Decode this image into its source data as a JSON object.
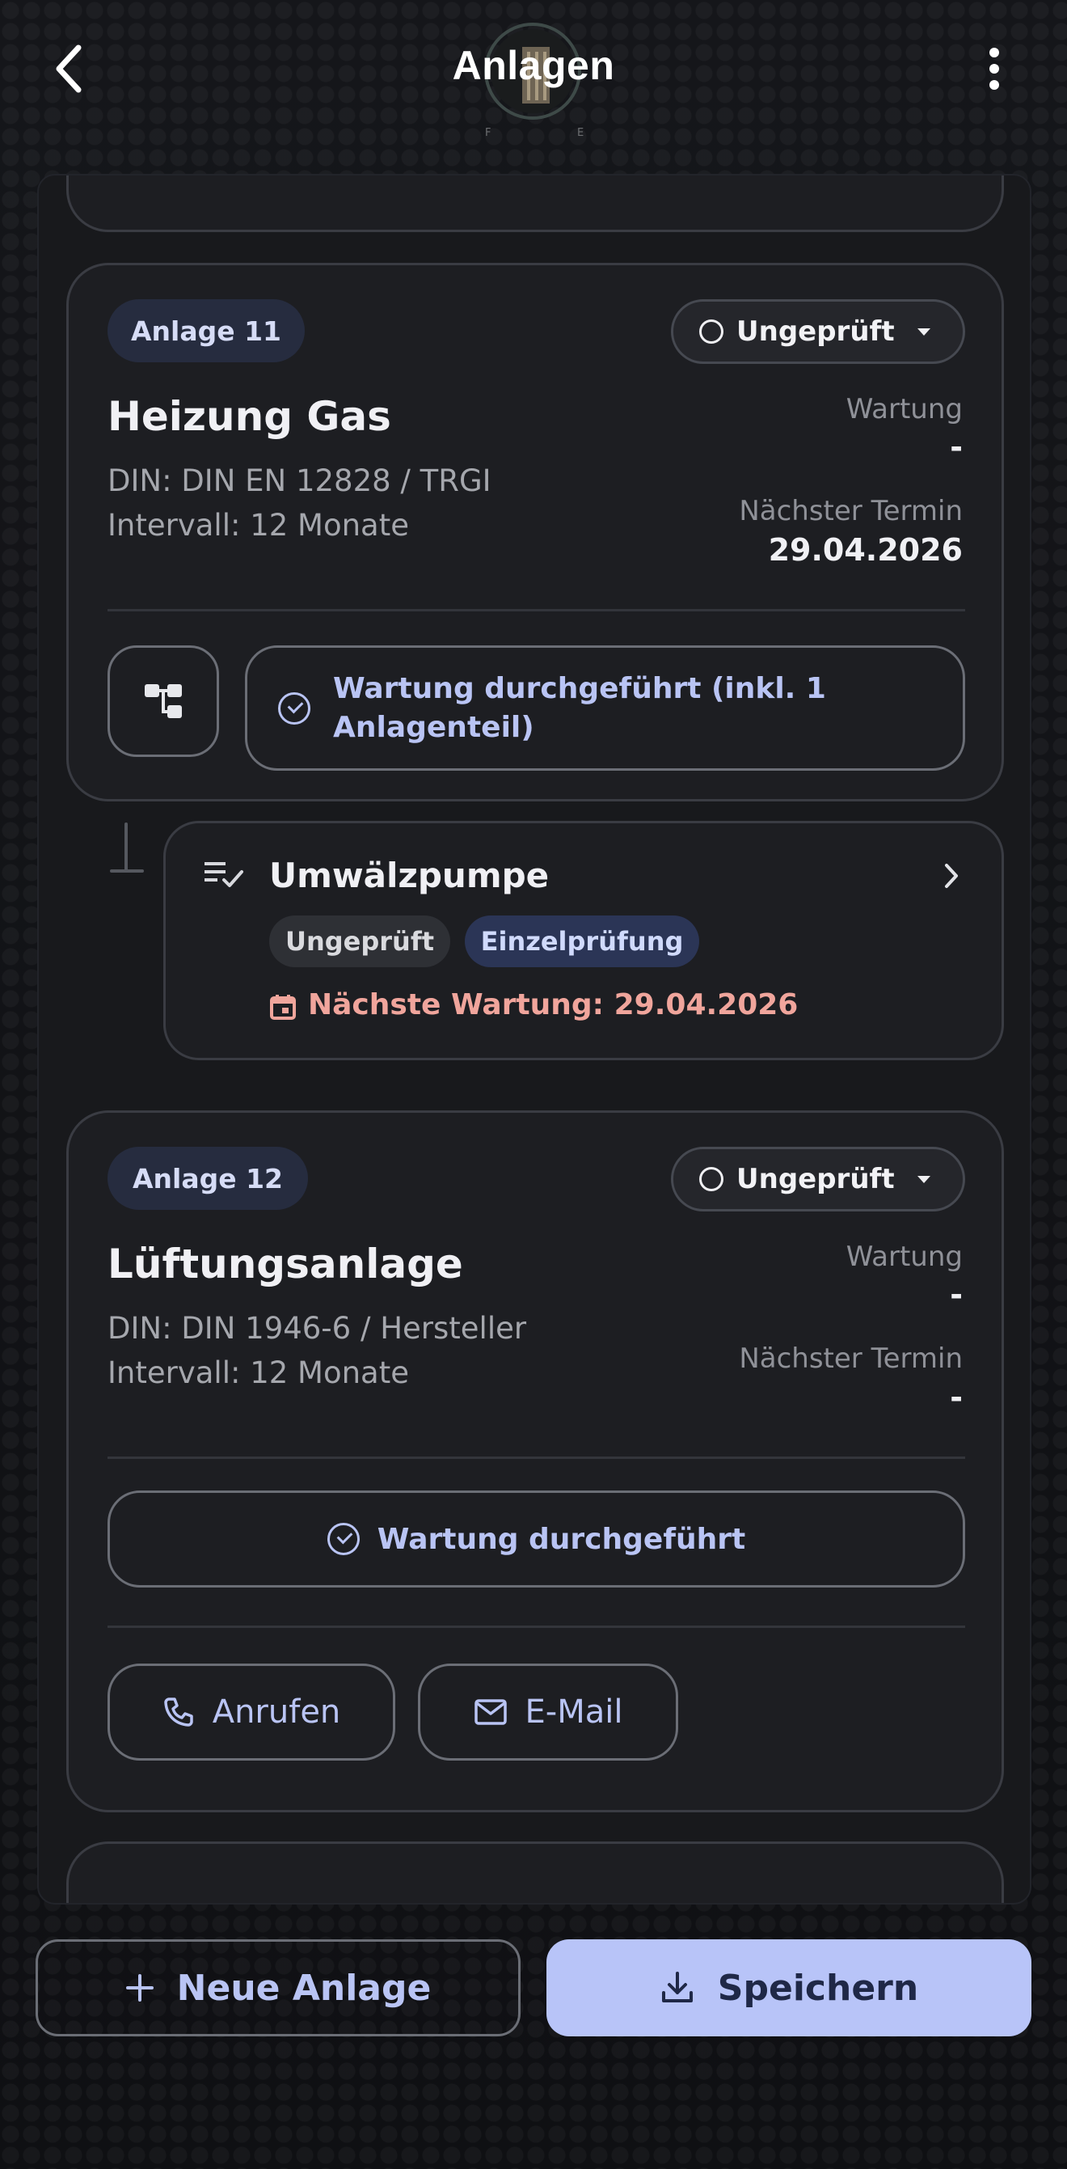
{
  "header": {
    "title": "Anlagen",
    "back_icon": "chevron-left-icon",
    "menu_icon": "more-vert-icon",
    "logo_icon": "company-logo"
  },
  "cards": [
    {
      "chip": "Anlage 11",
      "status": "Ungeprüft",
      "title": "Heizung Gas",
      "din": "DIN: DIN EN 12828 / TRGI",
      "interval": "Intervall: 12 Monate",
      "wartung_label": "Wartung",
      "wartung_value": "-",
      "next_label": "Nächster Termin",
      "next_value": "29.04.2026",
      "action_label": "Wartung durchgeführt (inkl. 1 Anlagenteil)",
      "hierarchy_icon": "hierarchy-icon"
    },
    {
      "chip": "Anlage 12",
      "status": "Ungeprüft",
      "title": "Lüftungsanlage",
      "din": "DIN: DIN 1946-6 / Hersteller",
      "interval": "Intervall: 12 Monate",
      "wartung_label": "Wartung",
      "wartung_value": "-",
      "next_label": "Nächster Termin",
      "next_value": "-",
      "action_label": "Wartung durchgeführt",
      "call_label": "Anrufen",
      "email_label": "E-Mail"
    }
  ],
  "subpart": {
    "title": "Umwälzpumpe",
    "tag_status": "Ungeprüft",
    "tag_type": "Einzelprüfung",
    "next_maintenance": "Nächste Wartung: 29.04.2026"
  },
  "footer": {
    "new_label": "Neue Anlage",
    "save_label": "Speichern"
  },
  "colors": {
    "accent": "#b9c4f4",
    "save_bg": "#b8c4f8",
    "warning_text": "#f0a59c",
    "card_bg": "#1d1e22"
  }
}
